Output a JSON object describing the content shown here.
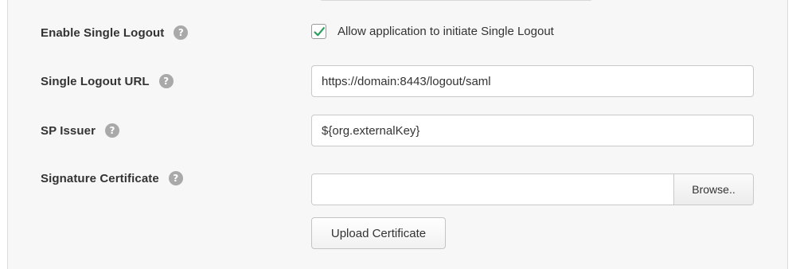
{
  "fields": {
    "single_logout": {
      "label": "Enable Single Logout",
      "help_icon": "question-circle-icon",
      "help_glyph": "?",
      "checkbox_checked": true,
      "checkbox_label": "Allow application to initiate Single Logout"
    },
    "single_logout_url": {
      "label": "Single Logout URL",
      "help_glyph": "?",
      "value": "https://domain:8443/logout/saml"
    },
    "sp_issuer": {
      "label": "SP Issuer",
      "help_glyph": "?",
      "value": "${org.externalKey}"
    },
    "signature_certificate": {
      "label": "Signature Certificate",
      "help_glyph": "?",
      "file_value": "",
      "browse_label": "Browse..",
      "upload_label": "Upload Certificate"
    }
  },
  "colors": {
    "panel_bg": "#f7f7f7",
    "check_mark": "#2e9e5e",
    "help_icon_bg": "#a9a9a9",
    "text": "#333333"
  }
}
